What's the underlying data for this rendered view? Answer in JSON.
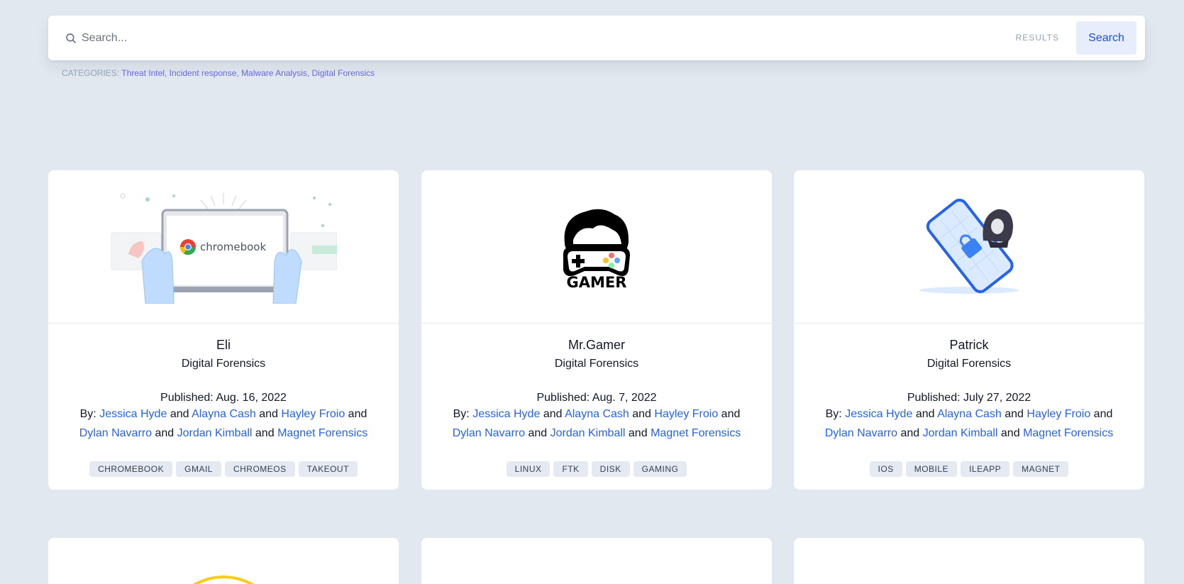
{
  "search": {
    "placeholder": "Search...",
    "results_label": "RESULTS",
    "button_label": "Search"
  },
  "categories": {
    "label": "CATEGORIES:",
    "items": [
      "Threat Intel",
      "Incident response",
      "Malware Analysis",
      "Digital Forensics"
    ]
  },
  "cards": [
    {
      "title": "Eli",
      "category": "Digital Forensics",
      "published": "Published: Aug. 16, 2022",
      "by": "By:",
      "authors": [
        "Jessica Hyde",
        "Alayna Cash",
        "Hayley Froio",
        "Dylan Navarro",
        "Jordan Kimball",
        "Magnet Forensics"
      ],
      "and": "and",
      "image": "chromebook-illustration",
      "image_text": "chromebook",
      "tags": [
        "CHROMEBOOK",
        "GMAIL",
        "CHROMEOS",
        "TAKEOUT"
      ]
    },
    {
      "title": "Mr.Gamer",
      "category": "Digital Forensics",
      "published": "Published: Aug. 7, 2022",
      "by": "By:",
      "authors": [
        "Jessica Hyde",
        "Alayna Cash",
        "Hayley Froio",
        "Dylan Navarro",
        "Jordan Kimball",
        "Magnet Forensics"
      ],
      "and": "and",
      "image": "gamer-logo",
      "image_text": "GAMER",
      "tags": [
        "LINUX",
        "FTK",
        "DISK",
        "GAMING"
      ]
    },
    {
      "title": "Patrick",
      "category": "Digital Forensics",
      "published": "Published: July 27, 2022",
      "by": "By:",
      "authors": [
        "Jessica Hyde",
        "Alayna Cash",
        "Hayley Froio",
        "Dylan Navarro",
        "Jordan Kimball",
        "Magnet Forensics"
      ],
      "and": "and",
      "image": "locked-phone-hacker-illustration",
      "tags": [
        "IOS",
        "MOBILE",
        "ILEAPP",
        "MAGNET"
      ]
    }
  ],
  "colors": {
    "background": "#e2e8f0",
    "link": "#2563eb",
    "category_link": "#6366f1",
    "search_button_bg": "#e8edfb"
  }
}
